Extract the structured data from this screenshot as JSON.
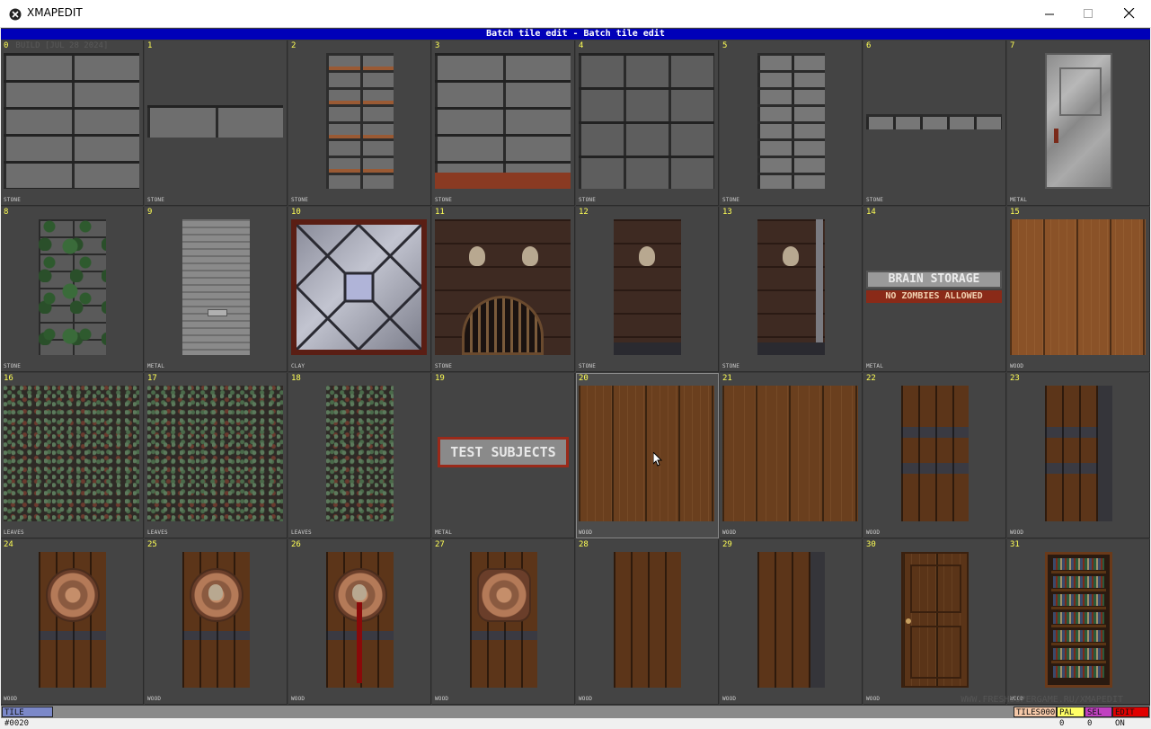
{
  "window": {
    "title": "XMAPEDIT",
    "controls": [
      "minimize-icon",
      "maximize-icon",
      "close-icon"
    ]
  },
  "header": {
    "title": "Batch tile edit - Batch tile edit"
  },
  "tiles": [
    {
      "num": "0",
      "extra": "BUILD [JUL 28 2024]",
      "surface": "STONE"
    },
    {
      "num": "1",
      "surface": "STONE"
    },
    {
      "num": "2",
      "surface": "STONE"
    },
    {
      "num": "3",
      "surface": "STONE"
    },
    {
      "num": "4",
      "surface": "STONE"
    },
    {
      "num": "5",
      "surface": "STONE"
    },
    {
      "num": "6",
      "surface": "STONE"
    },
    {
      "num": "7",
      "surface": "METAL"
    },
    {
      "num": "8",
      "surface": "STONE"
    },
    {
      "num": "9",
      "surface": "METAL"
    },
    {
      "num": "10",
      "surface": "CLAY"
    },
    {
      "num": "11",
      "surface": "STONE"
    },
    {
      "num": "12",
      "surface": "STONE"
    },
    {
      "num": "13",
      "surface": "STONE"
    },
    {
      "num": "14",
      "surface": "METAL",
      "sign1": "BRAIN STORAGE",
      "sign2": "NO ZOMBIES ALLOWED"
    },
    {
      "num": "15",
      "surface": "WOOD"
    },
    {
      "num": "16",
      "surface": "LEAVES"
    },
    {
      "num": "17",
      "surface": "LEAVES"
    },
    {
      "num": "18",
      "surface": "LEAVES"
    },
    {
      "num": "19",
      "surface": "METAL",
      "sign1": "TEST SUBJECTS"
    },
    {
      "num": "20",
      "surface": "WOOD"
    },
    {
      "num": "21",
      "surface": "WOOD"
    },
    {
      "num": "22",
      "surface": "WOOD"
    },
    {
      "num": "23",
      "surface": "WOOD"
    },
    {
      "num": "24",
      "surface": "WOOD"
    },
    {
      "num": "25",
      "surface": "WOOD"
    },
    {
      "num": "26",
      "surface": "WOOD"
    },
    {
      "num": "27",
      "surface": "WOOD"
    },
    {
      "num": "28",
      "surface": "WOOD"
    },
    {
      "num": "29",
      "surface": "WOOD"
    },
    {
      "num": "30",
      "surface": "WOOD"
    },
    {
      "num": "31",
      "surface": "WOOD"
    }
  ],
  "watermark": "WWW.FRESHSUPERGAME.RU/XMAPEDIT",
  "statusbar": {
    "tile": "TILE #0020",
    "tiles": "TILES000",
    "pal": "PAL 0",
    "sel": "SEL 0",
    "edit": "EDIT ON"
  },
  "colors": {
    "header_bg": "#0000b8",
    "tile_number": "#ffff55",
    "status_tiles": "#f5c8a8",
    "status_pal": "#ffff66",
    "status_sel": "#c040c0",
    "status_edit": "#e00000"
  }
}
